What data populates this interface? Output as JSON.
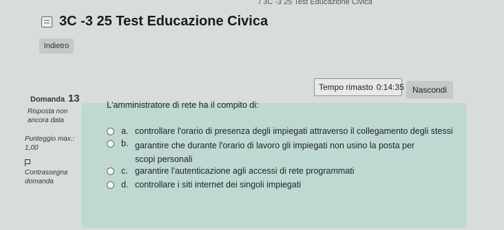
{
  "breadcrumb": "/ 3C -3 25 Test Educazione Civica",
  "page_title": "3C -3 25 Test Educazione Civica",
  "back_label": "Indietro",
  "timer": {
    "label": "Tempo rimasto",
    "value": "0:14:35"
  },
  "hide_label": "Nascondi",
  "question_info": {
    "label": "Domanda",
    "number": "13",
    "status": [
      "Risposta non",
      "ancora data"
    ],
    "score": [
      "Punteggio max.:",
      "1,00"
    ],
    "flag": [
      "Contrassegna",
      "domanda"
    ]
  },
  "question_text": "L'amministratore di rete ha il compito di:",
  "answers": [
    {
      "letter": "a.",
      "text": "controllare l'orario di presenza degli impiegati attraverso il collegamento degli stessi"
    },
    {
      "letter": "b.",
      "text": "garantire che durante l'orario di lavoro gli impiegati non usino la posta per scopi personali"
    },
    {
      "letter": "c.",
      "text": "garantire l'autenticazione agli accessi di rete programmati"
    },
    {
      "letter": "d.",
      "text": "controllare i siti internet dei singoli impiegati"
    }
  ]
}
